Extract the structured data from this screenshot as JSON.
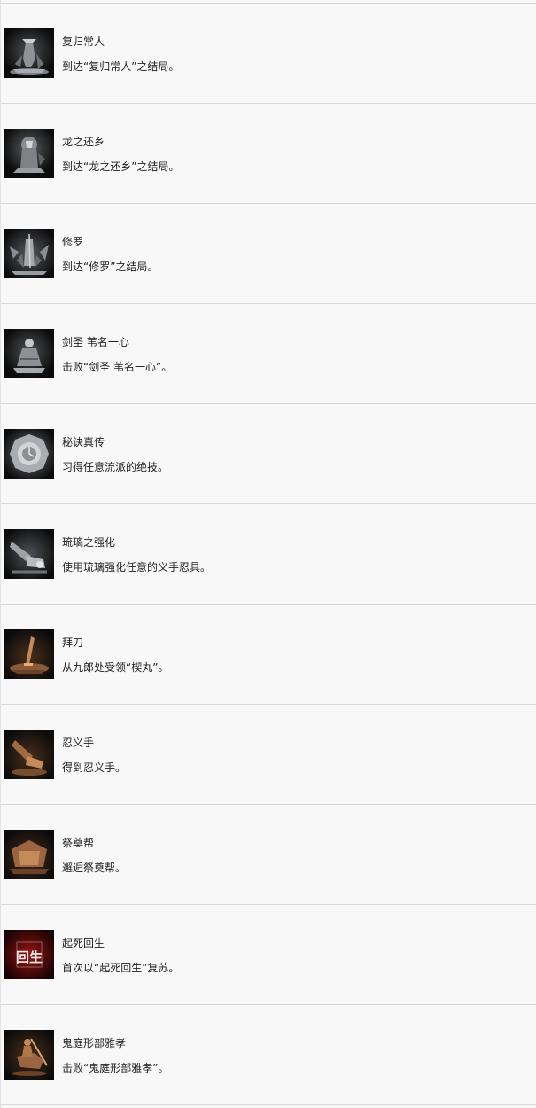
{
  "achievements": [
    {
      "title": "复归常人",
      "description": "到达“复归常人”之结局。",
      "icon": "statue-figure-icon",
      "icon_tone": "silver"
    },
    {
      "title": "龙之还乡",
      "description": "到达“龙之还乡”之结局。",
      "icon": "dragon-homecoming-icon",
      "icon_tone": "silver"
    },
    {
      "title": "修罗",
      "description": "到达“修罗”之结局。",
      "icon": "shura-icon",
      "icon_tone": "silver"
    },
    {
      "title": "剑圣 苇名一心",
      "description": "击败“剑圣 苇名一心”。",
      "icon": "sword-saint-icon",
      "icon_tone": "silver"
    },
    {
      "title": "秘诀真传",
      "description": "习得任意流派的绝技。",
      "icon": "mirror-icon",
      "icon_tone": "silver"
    },
    {
      "title": "琉璃之强化",
      "description": "使用琉璃强化任意的义手忍具。",
      "icon": "prosthetic-arm-icon",
      "icon_tone": "silver"
    },
    {
      "title": "拜刀",
      "description": "从九郎处受领“楔丸”。",
      "icon": "katana-icon",
      "icon_tone": "bronze"
    },
    {
      "title": "忍义手",
      "description": "得到忍义手。",
      "icon": "shinobi-prosthetic-icon",
      "icon_tone": "bronze"
    },
    {
      "title": "祭奠帮",
      "description": "邂逅祭奠帮。",
      "icon": "shrine-tent-icon",
      "icon_tone": "bronze"
    },
    {
      "title": "起死回生",
      "description": "首次以“起死回生”复苏。",
      "icon": "resurrection-kanji-icon",
      "icon_tone": "red",
      "icon_text": "回生"
    },
    {
      "title": "鬼庭形部雅孝",
      "description": "击败“鬼庭形部雅孝”。",
      "icon": "mounted-warrior-icon",
      "icon_tone": "bronze"
    }
  ],
  "colors": {
    "silver": "#9a9ea3",
    "bronze": "#8a5a38",
    "red": "#c21d1d",
    "row_border": "#d8d8d8",
    "background": "#f8f8f8"
  }
}
